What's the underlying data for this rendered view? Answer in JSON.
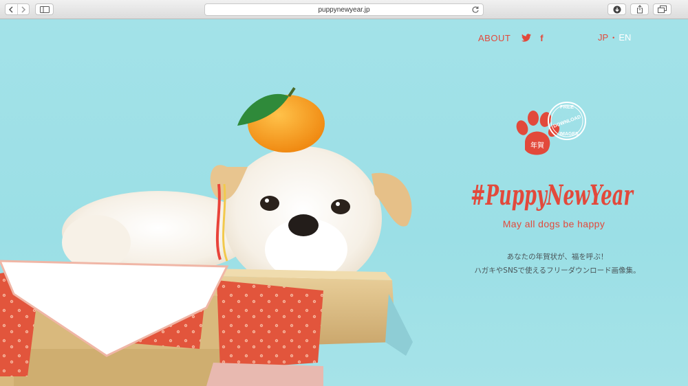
{
  "browser": {
    "url": "puppynewyear.jp"
  },
  "nav": {
    "about": "ABOUT",
    "facebook": "f"
  },
  "lang": {
    "jp": "JP",
    "separator": "•",
    "en": "EN"
  },
  "stamp": {
    "text_top": "FREE",
    "text_middle": "DOWNLOAD",
    "text_bottom": "IMAGES",
    "kanji": "年賀"
  },
  "hero": {
    "title": "#PuppyNewYear",
    "tagline": "May all dogs be happy",
    "description_line1": "あなたの年賀状が、福を呼ぶ！",
    "description_line2": "ハガキやSNSで使えるフリーダウンロード画像集。"
  },
  "colors": {
    "accent": "#e2493b",
    "sky": "#9fe0e6"
  }
}
